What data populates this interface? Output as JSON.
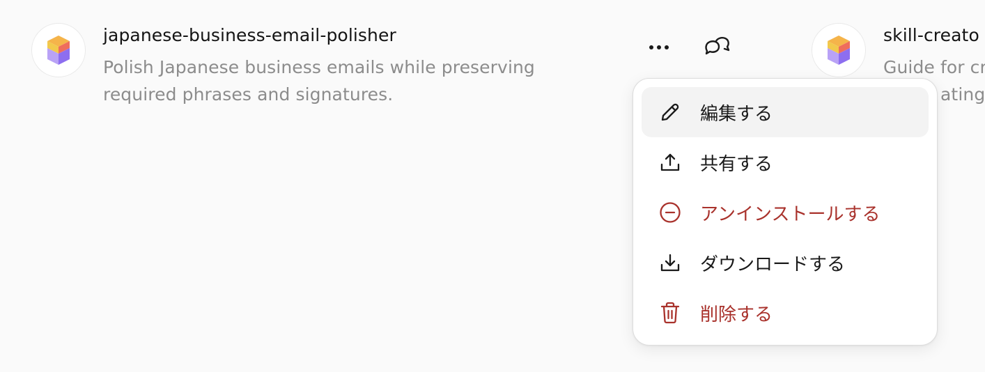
{
  "skills": [
    {
      "title": "japanese-business-email-polisher",
      "description": "Polish Japanese business emails while preserving required phrases and signatures."
    },
    {
      "title": "skill-creato",
      "description_line1": "Guide for cr",
      "description_line2": "ating "
    }
  ],
  "context_menu": {
    "items": [
      {
        "label": "編集する",
        "icon": "pencil-icon"
      },
      {
        "label": "共有する",
        "icon": "share-upload-icon"
      },
      {
        "label": "アンインストールする",
        "icon": "minus-circle-icon",
        "color": "#a9322c"
      },
      {
        "label": "ダウンロードする",
        "icon": "download-icon"
      },
      {
        "label": "削除する",
        "icon": "trash-icon",
        "color": "#a9322c"
      }
    ]
  },
  "colors": {
    "danger": "#a9322c",
    "hover_bg": "#f3f3f3",
    "muted_text": "#8c8c8c"
  }
}
